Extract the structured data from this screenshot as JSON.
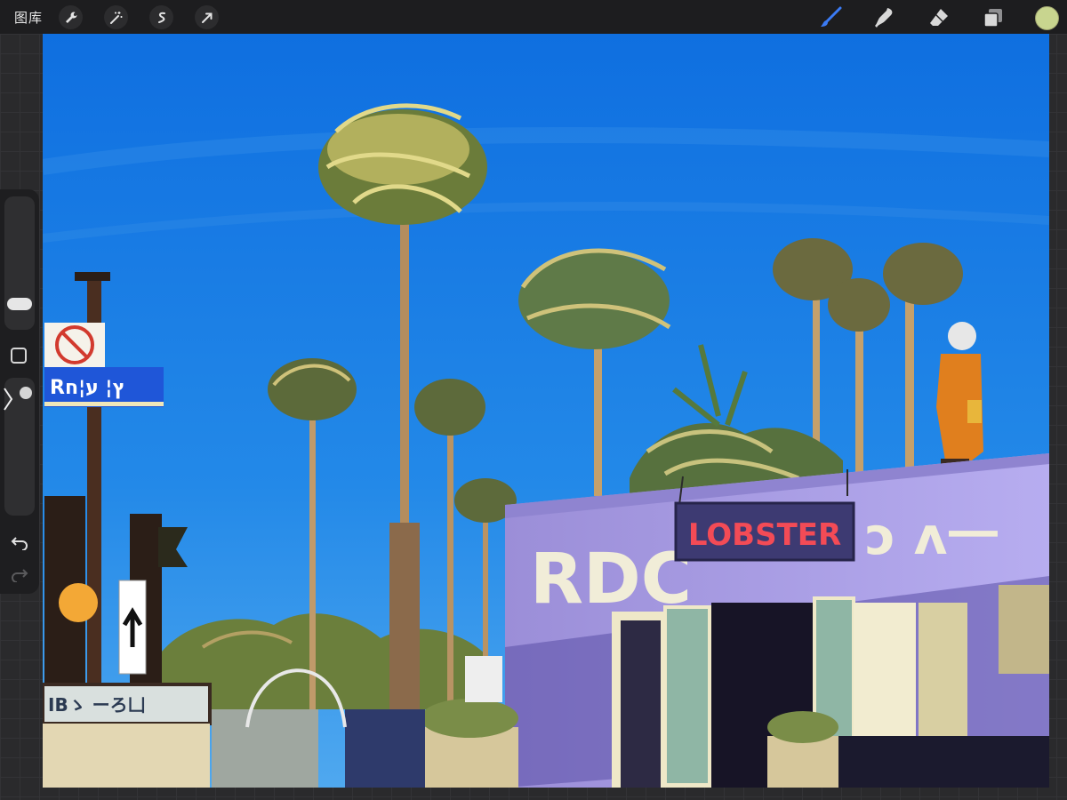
{
  "toolbar": {
    "gallery_label": "图库",
    "left_tools": [
      "wrench-icon",
      "magic-wand-icon",
      "selection-icon",
      "transform-arrow-icon"
    ],
    "right_tools": [
      "brush-icon",
      "smudge-icon",
      "eraser-icon",
      "layers-icon"
    ],
    "active_tool": "brush-icon",
    "current_color": "#c8d58f"
  },
  "sidebar": {
    "brush_size_level": 0.55,
    "opacity_level": 0.5
  },
  "artwork": {
    "sign_blue": "Rץ¦ ע¦ח",
    "sign_bottom": "IBゝ ーろ凵",
    "lobster_sign": "LOBSTER",
    "wall_text_left": "RDC",
    "wall_text_right": "ɔ ʌ一"
  },
  "colors": {
    "sky": "#1f7ee0",
    "wall": "#a99ae0",
    "lobster_red": "#e8424c",
    "accent_blue": "#4a78ff"
  }
}
